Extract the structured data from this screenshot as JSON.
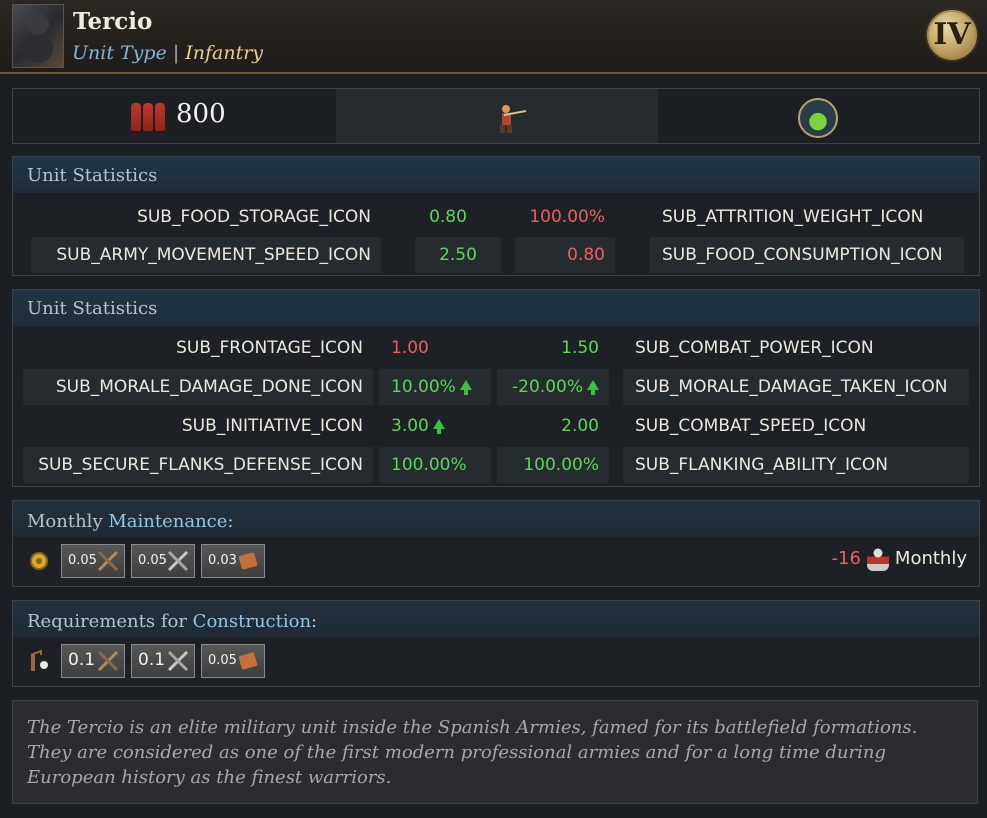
{
  "header": {
    "title": "Tercio",
    "unit_type_label": "Unit Type",
    "separator": "|",
    "unit_type_value": "Infantry",
    "tier": "IV",
    "portrait_icon": "tercio-soldier-portrait"
  },
  "summary": {
    "count": "800",
    "troops_icon": "soldiers-icon",
    "unit_icon": "musketeer-icon",
    "tech_icon": "flask-icon"
  },
  "stats1": {
    "title": "Unit Statistics",
    "rows": [
      {
        "left_label": "SUB_FOOD_STORAGE_ICON",
        "left_value": "0.80",
        "right_value": "100.00%",
        "right_label": "SUB_ATTRITION_WEIGHT_ICON"
      },
      {
        "left_label": "SUB_ARMY_MOVEMENT_SPEED_ICON",
        "left_value": "2.50",
        "right_value": "0.80",
        "right_label": "SUB_FOOD_CONSUMPTION_ICON"
      }
    ]
  },
  "stats2": {
    "title": "Unit Statistics",
    "rows": [
      {
        "left_label": "SUB_FRONTAGE_ICON",
        "left_value": "1.00",
        "right_value": "1.50",
        "right_label": "SUB_COMBAT_POWER_ICON"
      },
      {
        "left_label": "SUB_MORALE_DAMAGE_DONE_ICON",
        "left_value": "10.00%",
        "right_value": "-20.00%",
        "right_label": "SUB_MORALE_DAMAGE_TAKEN_ICON"
      },
      {
        "left_label": "SUB_INITIATIVE_ICON",
        "left_value": "3.00",
        "right_value": "2.00",
        "right_label": "SUB_COMBAT_SPEED_ICON"
      },
      {
        "left_label": "SUB_SECURE_FLANKS_DEFENSE_ICON",
        "left_value": "100.00%",
        "right_value": "100.00%",
        "right_label": "SUB_FLANKING_ABILITY_ICON"
      }
    ]
  },
  "maintenance": {
    "label_prefix": "Monthly ",
    "label_highlight": "Maintenance",
    "label_suffix": ":",
    "lead_icon": "gold-coins-icon",
    "costs": [
      {
        "value": "0.05",
        "icon": "crossed-muskets-icon"
      },
      {
        "value": "0.05",
        "icon": "crossed-swords-icon"
      },
      {
        "value": "0.03",
        "icon": "leather-icon"
      }
    ],
    "monthly_value": "-16",
    "monthly_icon": "manpower-icon",
    "monthly_label": "Monthly"
  },
  "construction": {
    "label_prefix": "Requirements for ",
    "label_highlight": "Construction",
    "label_suffix": ":",
    "lead_icon": "workshop-icon",
    "costs": [
      {
        "value": "0.1",
        "icon": "crossed-muskets-icon"
      },
      {
        "value": "0.1",
        "icon": "crossed-swords-icon"
      },
      {
        "value": "0.05",
        "icon": "leather-icon"
      }
    ]
  },
  "description": "The Tercio is an elite military unit inside the Spanish Armies, famed for its battlefield formations. They are considered as one of the first modern professional armies and for a long time during European history as the finest warriors.",
  "colors": {
    "positive": "#5cd65c",
    "negative": "#e86060",
    "highlight": "#8cc8ee",
    "infantry": "#e8d08a"
  }
}
